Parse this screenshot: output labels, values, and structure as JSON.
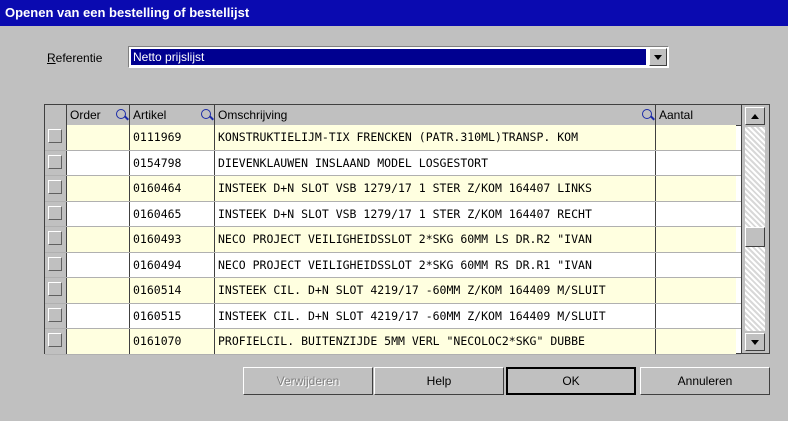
{
  "window": {
    "title": "Openen van een bestelling of bestellijst"
  },
  "referentie": {
    "label_mnemonic": "R",
    "label_rest": "eferentie",
    "value": "Netto prijslijst"
  },
  "grid": {
    "columns": [
      "Order",
      "Artikel",
      "Omschrijving",
      "Aantal"
    ],
    "rows": [
      {
        "order": "",
        "artikel": "0111969",
        "omschrijving": "KONSTRUKTIELIJM-TIX FRENCKEN (PATR.310ML)TRANSP. KOM",
        "aantal": ""
      },
      {
        "order": "",
        "artikel": "0154798",
        "omschrijving": "DIEVENKLAUWEN INSLAAND MODEL LOSGESTORT",
        "aantal": ""
      },
      {
        "order": "",
        "artikel": "0160464",
        "omschrijving": "INSTEEK D+N SLOT VSB 1279/17 1 STER Z/KOM 164407 LINKS",
        "aantal": ""
      },
      {
        "order": "",
        "artikel": "0160465",
        "omschrijving": "INSTEEK D+N SLOT VSB 1279/17 1 STER Z/KOM 164407 RECHT",
        "aantal": ""
      },
      {
        "order": "",
        "artikel": "0160493",
        "omschrijving": "NECO PROJECT VEILIGHEIDSSLOT 2*SKG 60MM LS DR.R2 \"IVAN",
        "aantal": ""
      },
      {
        "order": "",
        "artikel": "0160494",
        "omschrijving": "NECO PROJECT VEILIGHEIDSSLOT 2*SKG 60MM RS DR.R1 \"IVAN",
        "aantal": ""
      },
      {
        "order": "",
        "artikel": "0160514",
        "omschrijving": "INSTEEK CIL. D+N SLOT 4219/17 -60MM Z/KOM 164409 M/SLUIT",
        "aantal": ""
      },
      {
        "order": "",
        "artikel": "0160515",
        "omschrijving": "INSTEEK CIL. D+N SLOT 4219/17 -60MM Z/KOM 164409 M/SLUIT",
        "aantal": ""
      },
      {
        "order": "",
        "artikel": "0161070",
        "omschrijving": "PROFIELCIL. BUITENZIJDE 5MM VERL \"NECOLOC2*SKG\" DUBBE",
        "aantal": ""
      }
    ]
  },
  "buttons": {
    "verwijderen": "Verwijderen",
    "help": "Help",
    "ok": "OK",
    "annuleren": "Annuleren"
  },
  "colors": {
    "titlebar": "#0a0ab0",
    "alt_row": "#ffffe0",
    "selection": "#000090"
  }
}
